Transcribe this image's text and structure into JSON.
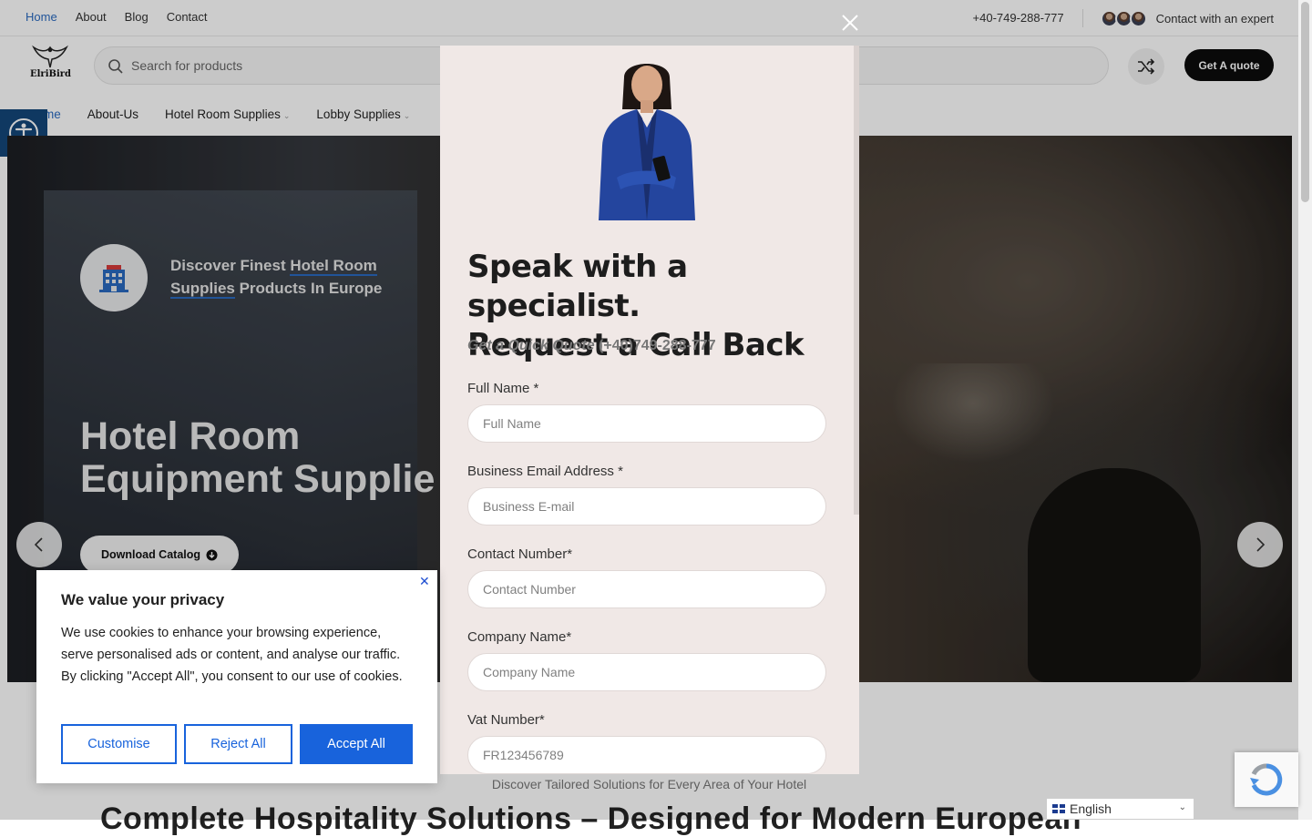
{
  "topbar": {
    "nav": [
      "Home",
      "About",
      "Blog",
      "Contact"
    ],
    "phone": "+40-749-288-777",
    "contact_expert": "Contact with an expert"
  },
  "header": {
    "logo_text": "ElriBird",
    "search_placeholder": "Search for products",
    "quote_button": "Get A quote"
  },
  "mainnav": {
    "items": [
      "me",
      "About-Us",
      "Hotel Room Supplies",
      "Lobby Supplies"
    ]
  },
  "hero": {
    "badge_prefix": "Discover Finest ",
    "badge_highlight_1": "Hotel Room",
    "badge_highlight_2": "Supplies",
    "badge_suffix": " Products In Europe",
    "title_line1": "Hotel Room",
    "title_line2": "Equipment Supplie",
    "download_button": "Download Catalog"
  },
  "modal": {
    "title_line1": "Speak with a specialist.",
    "title_line2": "Request a Call Back",
    "quote_label": "Get a Quick Quote",
    "quote_phone": "(+40)749-288-777",
    "fields": [
      {
        "label": "Full Name *",
        "placeholder": "Full Name"
      },
      {
        "label": "Business Email Address *",
        "placeholder": "Business E-mail"
      },
      {
        "label": "Contact Number*",
        "placeholder": "Contact Number"
      },
      {
        "label": "Company Name*",
        "placeholder": "Company Name"
      },
      {
        "label": "Vat Number*",
        "placeholder": "FR123456789"
      }
    ]
  },
  "below_hero": {
    "subtitle": "Discover Tailored Solutions for Every Area of Your Hotel",
    "heading": "Complete Hospitality Solutions – Designed for Modern European"
  },
  "cookie": {
    "title": "We value your privacy",
    "text": "We use cookies to enhance your browsing experience, serve personalised ads or content, and analyse our traffic. By clicking \"Accept All\", you consent to our use of cookies.",
    "customise": "Customise",
    "reject": "Reject All",
    "accept": "Accept All"
  },
  "language": {
    "selected": "English"
  },
  "colors": {
    "accent_blue": "#2a6ac0",
    "cookie_blue": "#1863dc",
    "modal_bg": "#f0e8e6",
    "accessibility_bg": "#13467a"
  }
}
